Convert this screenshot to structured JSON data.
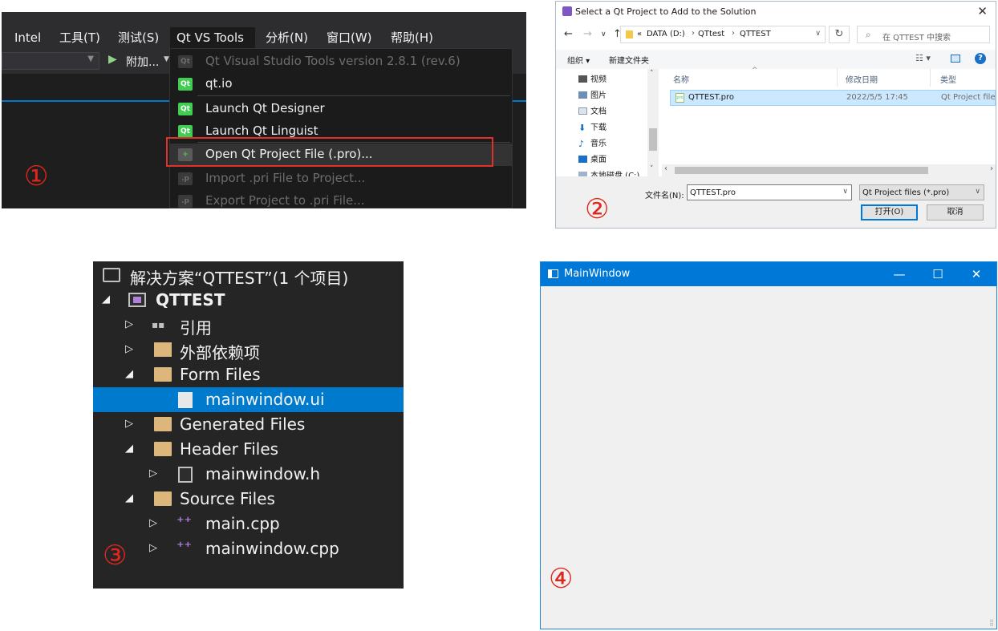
{
  "panel1": {
    "menubar": [
      "Intel",
      "工具(T)",
      "测试(S)",
      "Qt VS Tools",
      "分析(N)",
      "窗口(W)",
      "帮助(H)"
    ],
    "run_label": "附加...",
    "menu_items": [
      {
        "label": "Qt Visual Studio Tools version 2.8.1 (rev.6)",
        "disabled": true
      },
      {
        "label": "qt.io",
        "disabled": false
      },
      {
        "label": "Launch Qt Designer",
        "disabled": false
      },
      {
        "label": "Launch Qt Linguist",
        "disabled": false
      },
      {
        "label": "Open Qt Project File (.pro)...",
        "disabled": false,
        "highlighted": true
      },
      {
        "label": "Import .pri File to Project...",
        "disabled": true
      },
      {
        "label": "Export Project to .pri File...",
        "disabled": true
      }
    ],
    "step": "①"
  },
  "panel2": {
    "title": "Select a Qt Project to Add to the Solution",
    "breadcrumb": [
      "«",
      "DATA (D:)",
      "QTtest",
      "QTTEST"
    ],
    "search_placeholder": "在 QTTEST 中搜索",
    "organize": "组织",
    "new_folder": "新建文件夹",
    "tree": [
      "视频",
      "图片",
      "文档",
      "下载",
      "音乐",
      "桌面",
      "本地磁盘 (C:)"
    ],
    "columns": [
      "名称",
      "修改日期",
      "类型"
    ],
    "file": {
      "name": "QTTEST.pro",
      "date": "2022/5/5 17:45",
      "type": "Qt Project file"
    },
    "filename_label": "文件名(N):",
    "filename_value": "QTTEST.pro",
    "filetype": "Qt Project files (*.pro)",
    "open_button": "打开(O)",
    "cancel_button": "取消",
    "step": "②"
  },
  "panel3": {
    "solution": "解决方案“QTTEST”(1 个项目)",
    "project": "QTTEST",
    "items": [
      {
        "label": "引用"
      },
      {
        "label": "外部依赖项"
      },
      {
        "label": "Form Files"
      },
      {
        "label": "mainwindow.ui"
      },
      {
        "label": "Generated Files"
      },
      {
        "label": "Header Files"
      },
      {
        "label": "mainwindow.h"
      },
      {
        "label": "Source Files"
      },
      {
        "label": "main.cpp"
      },
      {
        "label": "mainwindow.cpp"
      }
    ],
    "step": "③"
  },
  "panel4": {
    "title": "MainWindow",
    "step": "④"
  },
  "colors": {
    "vs_dark": "#2d2d30",
    "vs_accent": "#007acc",
    "qt_green": "#41cd52",
    "win_blue": "#0078d7",
    "annotation_red": "#e0261b"
  }
}
